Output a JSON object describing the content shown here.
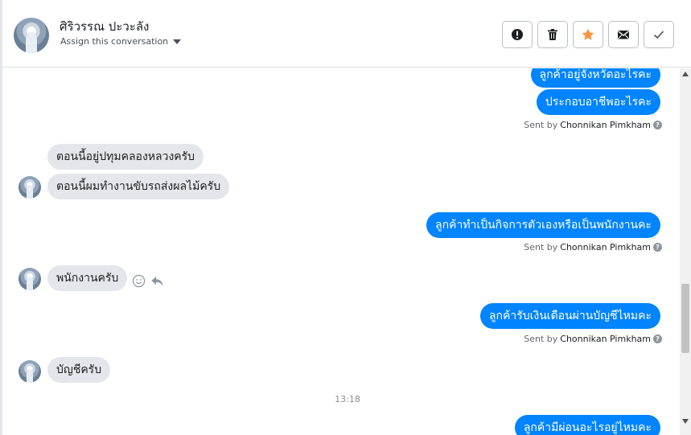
{
  "header": {
    "contact_name": "ศิริวรรณ ปะวะลัง",
    "assign_label": "Assign this conversation",
    "actions": [
      {
        "name": "mark-spam-button",
        "icon": "exclamation-icon"
      },
      {
        "name": "delete-button",
        "icon": "trash-icon"
      },
      {
        "name": "star-button",
        "icon": "star-icon",
        "color": "#f7923b"
      },
      {
        "name": "mark-unread-button",
        "icon": "envelope-icon"
      },
      {
        "name": "mark-done-button",
        "icon": "checkmark-icon"
      }
    ]
  },
  "thread": {
    "messages": [
      {
        "dir": "out",
        "text": "ลูกค้าอยู่จังหวัดอะไรคะ"
      },
      {
        "dir": "out",
        "text": "ประกอบอาชีพอะไรคะ"
      },
      {
        "dir": "in",
        "text": "ตอนนี้อยู่ปทุมคลองหลวงครับ"
      },
      {
        "dir": "in",
        "text": "ตอนนี้ผมทำงานขับรถส่งผลไม้ครับ"
      },
      {
        "dir": "out",
        "text": "ลูกค้าทำเป็นกิจการตัวเองหรือเป็นพนักงานคะ"
      },
      {
        "dir": "in",
        "text": "พนักงานครับ"
      },
      {
        "dir": "out",
        "text": "ลูกค้ารับเงินเดือนผ่านบัญชีไหมคะ"
      },
      {
        "dir": "in",
        "text": "บัญชีครับ"
      },
      {
        "dir": "out",
        "text": "ลูกค้ามีผ่อนอะไรอยู่ไหมคะ"
      }
    ],
    "sent_by_prefix": "Sent by",
    "agent_name": "Chonnikan Pimkham",
    "help_glyph": "?",
    "timestamp": "13:18"
  },
  "colors": {
    "outgoing_bubble": "#0084ff",
    "incoming_bubble": "#e4e6eb",
    "star": "#f7923b"
  }
}
